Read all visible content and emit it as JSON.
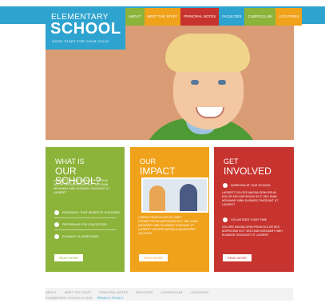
{
  "logo": {
    "line1": "ELEMENTARY",
    "line2": "SCHOOL",
    "tagline": "GOOD START FOR YOUR CHILD"
  },
  "nav": [
    {
      "label": "ABOUT",
      "color": "#8cb33a"
    },
    {
      "label": "MEET THE STAFF",
      "color": "#f0a21a"
    },
    {
      "label": "PRINCIPAL NOTES",
      "color": "#c7332e"
    },
    {
      "label": "FACULTIES",
      "color": "#2fa3cf"
    },
    {
      "label": "CURRICULUM",
      "color": "#8cb33a"
    },
    {
      "label": "LOCATIONS",
      "color": "#f0a21a"
    }
  ],
  "boxes": {
    "what": {
      "title_small": "WHAT IS",
      "title_big": "OUR SCHOOL?",
      "desc": "LAOREET DOLORE MAGNA ORIM IPSUM DOLOR SED ADIPISCING ELIT. SED DIAM NONUMMY NIBH EUISMOD TINCIDUNT UT LAOREET",
      "items": [
        "RESEARCH THAT BENEFITS CHILDREN",
        "PROGRAMS FOR EDUCATORS",
        "DYNAMIC CLASSROOMS"
      ],
      "button": "READ MORE",
      "color": "#8cb33a"
    },
    "impact": {
      "title_small": "OUR",
      "title_big": "IMPACT",
      "desc": "LOREM IPSUM DOLOR SIT AMET CONSECTETUR ADIPISCING ELIT. SED DIAM NONUMMY NIBH EUISMOD TINCIDUNT UT LAOREET DOLORE MAGNA ALIQUAM ERAT VOLUTPAT",
      "button": "READ MORE",
      "color": "#f0a21a"
    },
    "involved": {
      "title_small": "GET",
      "title_big": "INVOLVED",
      "item1": "WORKING AT OUR SCHOOL",
      "desc1": "LAOREET DOLORE MAGNA ORIM IPSUM DOLOR SED ADIPISCING ELIT. SED DIAM NONUMMY NIBH EUISMOD TINCIDUNT UT LAOREET",
      "item2": "VOLUNTEER YOUR TIME",
      "desc2": "DOLORE MAGNA ORIM IPSUM DOLOR SED ADIPISCING ELIT. SED DIAM NONUMMY NIBH EUISMOD TINCIDUNT UT LAOREET",
      "button": "READ MORE",
      "color": "#c7332e"
    }
  },
  "footer": {
    "links": [
      "ABOUT",
      "MEET THE STAFF",
      "PRINCIPAL NOTES",
      "FACULTIES",
      "CURRICULUM",
      "LOCATIONS"
    ],
    "copyright": "ELEMENTARY SCHOOL © 2015",
    "privacy": "PRIVACY POLICY"
  }
}
